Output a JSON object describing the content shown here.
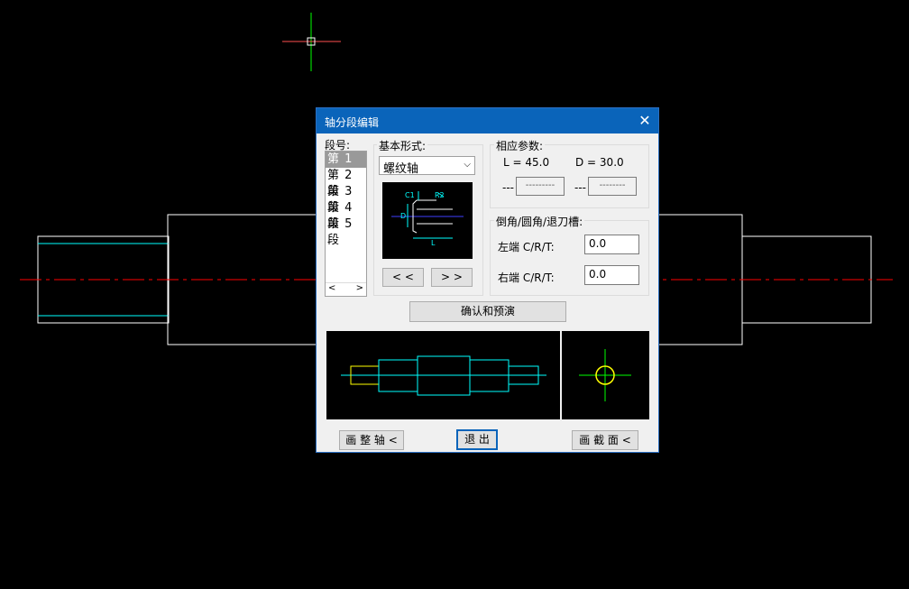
{
  "dialog": {
    "title": "轴分段编辑",
    "close_glyph": "✕",
    "segment_label": "段号:",
    "segments": [
      "第 1 段",
      "第 2 段",
      "第 3 段",
      "第 4 段",
      "第 5 段"
    ],
    "selected_segment": 0,
    "scroll_left": "<",
    "scroll_right": ">",
    "basic_form_label": "基本形式:",
    "basic_form_value": "螺纹轴",
    "basic_form_preview_labels": [
      "C1",
      "R2",
      "D",
      "L"
    ],
    "prev_button": "< <",
    "next_button": "> >",
    "params_label": "相应参数:",
    "param_L": "L = 45.0",
    "param_D": "D = 30.0",
    "param_extra1_prefix": "---",
    "param_extra1_value": "---------",
    "param_extra2_prefix": "---",
    "param_extra2_value": "--------",
    "chamfer_label": "倒角/圆角/退刀槽:",
    "left_label": "左端 C/R/T:",
    "left_value": "0.0",
    "right_label": "右端 C/R/T:",
    "right_value": "0.0",
    "confirm_button": "确认和预演",
    "draw_shaft_button": "画 整 轴 <",
    "exit_button": "退 出",
    "draw_section_button": "画 截 面 <"
  },
  "colors": {
    "title_bar": "#0a64ba",
    "centerline": "#ff0000",
    "outline": "#ffffff",
    "preview_cyan": "#00ffff",
    "preview_yellow": "#ffff00",
    "preview_green": "#00ff00"
  }
}
